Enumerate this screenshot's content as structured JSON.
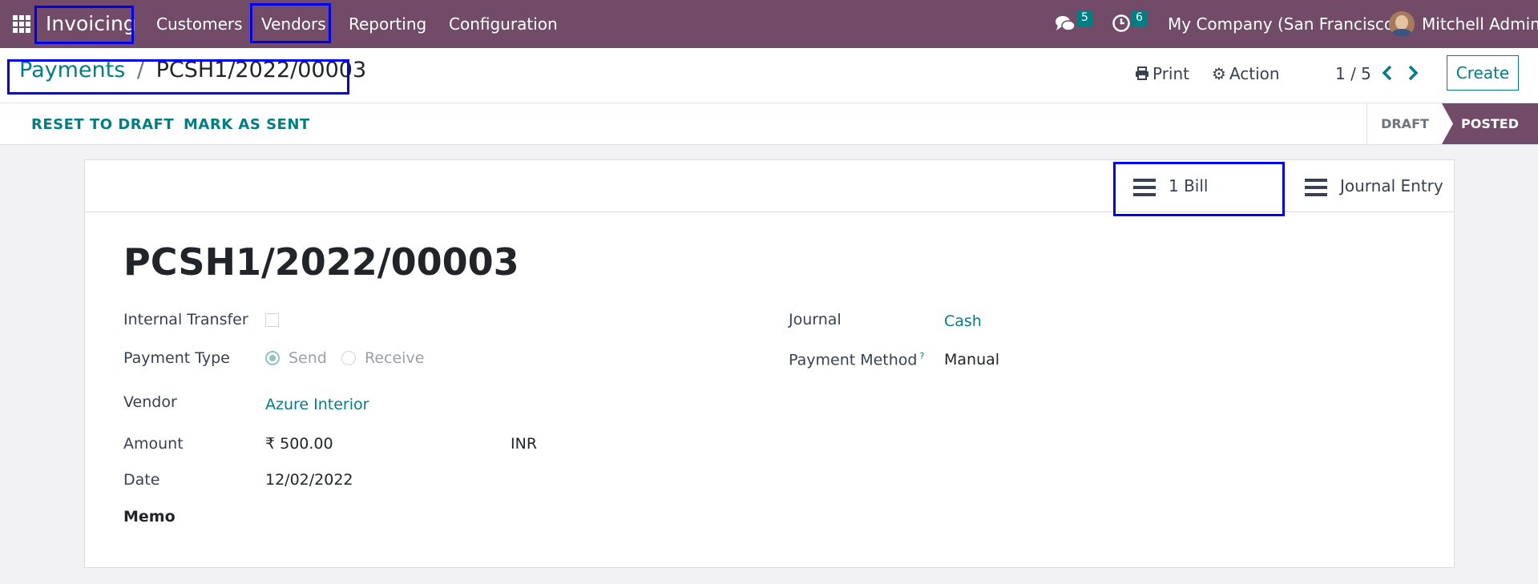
{
  "navbar": {
    "app_name": "Invoicing",
    "menu": [
      "Customers",
      "Vendors",
      "Reporting",
      "Configuration"
    ],
    "messages_count": "5",
    "activities_count": "6",
    "company": "My Company (San Francisco)",
    "user": "Mitchell Admin"
  },
  "breadcrumb": {
    "parent": "Payments",
    "separator": "/",
    "current": "PCSH1/2022/00003"
  },
  "control": {
    "print": "Print",
    "action": "Action",
    "pager": "1 / 5",
    "create": "Create"
  },
  "statusbar": {
    "buttons": [
      "RESET TO DRAFT",
      "MARK AS SENT"
    ],
    "stages": [
      "DRAFT",
      "POSTED"
    ],
    "active_stage": "POSTED"
  },
  "smart_buttons": {
    "bill": "1 Bill",
    "journal_entry": "Journal Entry"
  },
  "form": {
    "name": "PCSH1/2022/00003",
    "internal_transfer_label": "Internal Transfer",
    "internal_transfer": false,
    "payment_type_label": "Payment Type",
    "payment_type_options": [
      "Send",
      "Receive"
    ],
    "payment_type_selected": "Send",
    "vendor_label": "Vendor",
    "vendor": "Azure Interior",
    "amount_label": "Amount",
    "amount": "₹ 500.00",
    "currency": "INR",
    "date_label": "Date",
    "date": "12/02/2022",
    "memo_label": "Memo",
    "journal_label": "Journal",
    "journal": "Cash",
    "payment_method_label": "Payment Method",
    "payment_method_help": "?",
    "payment_method": "Manual"
  },
  "colors": {
    "brand": "#714b67",
    "accent": "#017e84",
    "highlight": "#0000ee"
  }
}
